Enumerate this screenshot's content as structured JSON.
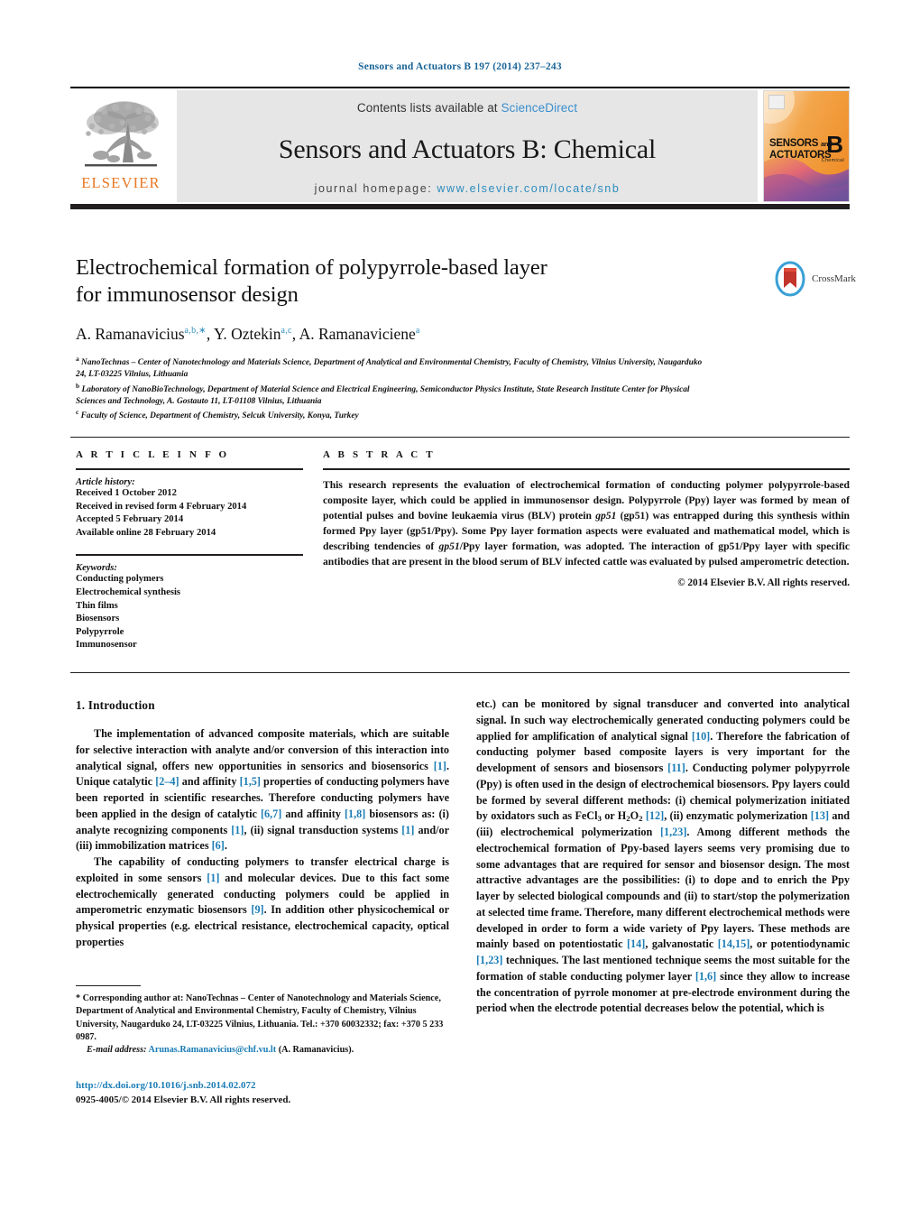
{
  "running_head": "Sensors and Actuators B 197 (2014) 237–243",
  "masthead": {
    "publisher_name": "ELSEVIER",
    "contents_prefix": "Contents lists available at ",
    "contents_link": "ScienceDirect",
    "journal_title": "Sensors and Actuators B: Chemical",
    "homepage_prefix": "journal homepage: ",
    "homepage_url": "www.elsevier.com/locate/snb",
    "cover": {
      "line1": "SENSORS",
      "line2": "ACTUATORS",
      "and": "and",
      "letter": "B",
      "sub": "Chemical"
    }
  },
  "article": {
    "title_line1": "Electrochemical formation of polypyrrole-based layer",
    "title_line2": "for immunosensor design",
    "authors_html": "A. Ramanavicius<sup>a,b,∗</sup>, Y. Oztekin<sup>a,c</sup>, A. Ramanaviciene<sup>a</sup>",
    "crossmark_label": "CrossMark",
    "affiliations": [
      {
        "marker": "a",
        "text": "NanoTechnas – Center of Nanotechnology and Materials Science, Department of Analytical and Environmental Chemistry, Faculty of Chemistry, Vilnius University, Naugarduko 24, LT-03225 Vilnius, Lithuania"
      },
      {
        "marker": "b",
        "text": "Laboratory of NanoBioTechnology, Department of Material Science and Electrical Engineering, Semiconductor Physics Institute, State Research Institute Center for Physical Sciences and Technology, A. Gostauto 11, LT-01108 Vilnius, Lithuania"
      },
      {
        "marker": "c",
        "text": "Faculty of Science, Department of Chemistry, Selcuk University, Konya, Turkey"
      }
    ]
  },
  "article_info": {
    "heading": "A R T I C L E    I N F O",
    "history_label": "Article history:",
    "history": [
      "Received 1 October 2012",
      "Received in revised form 4 February 2014",
      "Accepted 5 February 2014",
      "Available online 28 February 2014"
    ],
    "keywords_label": "Keywords:",
    "keywords": [
      "Conducting polymers",
      "Electrochemical synthesis",
      "Thin films",
      "Biosensors",
      "Polypyrrole",
      "Immunosensor"
    ]
  },
  "abstract": {
    "heading": "A B S T R A C T",
    "body_html": "This research represents the evaluation of electrochemical formation of conducting polymer polypyrrole-based composite layer, which could be applied in immunosensor design. Polypyrrole (Ppy) layer was formed by mean of potential pulses and bovine leukaemia virus (BLV) protein <em>gp51</em> (gp51) was entrapped during this synthesis within formed Ppy layer (gp51/Ppy). Some Ppy layer formation aspects were evaluated and mathematical model, which is describing tendencies of <em>gp51</em>/Ppy layer formation, was adopted. The interaction of gp51/Ppy layer with specific antibodies that are present in the blood serum of BLV infected cattle was evaluated by pulsed amperometric detection.",
    "copyright": "© 2014 Elsevier B.V. All rights reserved."
  },
  "introduction": {
    "heading": "1.  Introduction",
    "left_p1_html": "The implementation of advanced composite materials, which are suitable for selective interaction with analyte and/or conversion of this interaction into analytical signal, offers new opportunities in sensorics and biosensorics <span class=\"ref\">[1]</span>. Unique catalytic <span class=\"ref\">[2–4]</span> and affinity <span class=\"ref\">[1,5]</span> properties of conducting polymers have been reported in scientific researches. Therefore conducting polymers have been applied in the design of catalytic <span class=\"ref\">[6,7]</span> and affinity <span class=\"ref\">[1,8]</span> biosensors as: (i) analyte recognizing components <span class=\"ref\">[1]</span>, (ii) signal transduction systems <span class=\"ref\">[1]</span> and/or (iii) immobilization matrices <span class=\"ref\">[6]</span>.",
    "left_p2_html": "The capability of conducting polymers to transfer electrical charge is exploited in some sensors <span class=\"ref\">[1]</span> and molecular devices. Due to this fact some electrochemically generated conducting polymers could be applied in amperometric enzymatic biosensors <span class=\"ref\">[9]</span>. In addition other physicochemical or physical properties (e.g. electrical resistance, electrochemical capacity, optical properties",
    "right_p1_html": "etc.) can be monitored by signal transducer and converted into analytical signal. In such way electrochemically generated conducting polymers could be applied for amplification of analytical signal <span class=\"ref\">[10]</span>. Therefore the fabrication of conducting polymer based composite layers is very important for the development of sensors and biosensors <span class=\"ref\">[11]</span>. Conducting polymer polypyrrole (Ppy) is often used in the design of electrochemical biosensors. Ppy layers could be formed by several different methods: (i) chemical polymerization initiated by oxidators such as FeCl<sub>3</sub> or H<sub>2</sub>O<sub>2</sub> <span class=\"ref\">[12]</span>, (ii) enzymatic polymerization <span class=\"ref\">[13]</span> and (iii) electrochemical polymerization <span class=\"ref\">[1,23]</span>. Among different methods the electrochemical formation of Ppy-based layers seems very promising due to some advantages that are required for sensor and biosensor design. The most attractive advantages are the possibilities: (i) to dope and to enrich the Ppy layer by selected biological compounds and (ii) to start/stop the polymerization at selected time frame. Therefore, many different electrochemical methods were developed in order to form a wide variety of Ppy layers. These methods are mainly based on potentiostatic <span class=\"ref\">[14]</span>, galvanostatic <span class=\"ref\">[14,15]</span>, or potentiodynamic <span class=\"ref\">[1,23]</span> techniques. The last mentioned technique seems the most suitable for the formation of stable conducting polymer layer <span class=\"ref\">[1,6]</span> since they allow to increase the concentration of pyrrole monomer at pre-electrode environment during the period when the electrode potential decreases below the potential, which is"
  },
  "footnote": {
    "body_html": "<span class=\"indent\">*</span> Corresponding author at: NanoTechnas – Center of Nanotechnology and Materials Science, Department of Analytical and Environmental Chemistry, Faculty of Chemistry, Vilnius University, Naugarduko 24, LT-03225 Vilnius, Lithuania. Tel.: +370 60032332; fax: +370 5 233 0987.",
    "email_label": "E-mail address:",
    "email": "Arunas.Ramanavicius@chf.vu.lt",
    "email_suffix": "(A. Ramanavicius)."
  },
  "footer": {
    "doi": "http://dx.doi.org/10.1016/j.snb.2014.02.072",
    "issn_line": "0925-4005/© 2014 Elsevier B.V. All rights reserved."
  },
  "colors": {
    "link_blue": "#1a7cb5",
    "elsevier_orange": "#e87722",
    "sciencedirect_blue": "#3a8fce",
    "banner_grey": "#e6e6e6",
    "rule_black": "#231f20"
  }
}
